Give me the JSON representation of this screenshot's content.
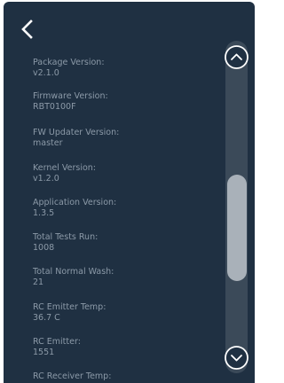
{
  "items": [
    {
      "label": "Package Version:",
      "value": "v2.1.0"
    },
    {
      "label": "Firmware Version:",
      "value": "RBT0100F"
    },
    {
      "label": "FW Updater Version:",
      "value": "master"
    },
    {
      "label": "Kernel Version:",
      "value": "v1.2.0"
    },
    {
      "label": "Application Version:",
      "value": "1.3.5"
    },
    {
      "label": "Total Tests Run:",
      "value": "1008"
    },
    {
      "label": "Total Normal Wash:",
      "value": "21"
    },
    {
      "label": "RC Emitter Temp:",
      "value": "36.7 C"
    },
    {
      "label": "RC Emitter:",
      "value": "1551"
    },
    {
      "label": "RC Receiver Temp:",
      "value": ""
    }
  ],
  "icons": {
    "back": "chevron-left-icon",
    "scroll_up": "chevron-up-circle-icon",
    "scroll_down": "chevron-down-circle-icon"
  },
  "colors": {
    "background": "#1f3042",
    "text": "#8c9aa8",
    "scroll_track": "#3b4a59",
    "scroll_thumb": "#a9b1b9",
    "icon": "#ffffff"
  }
}
